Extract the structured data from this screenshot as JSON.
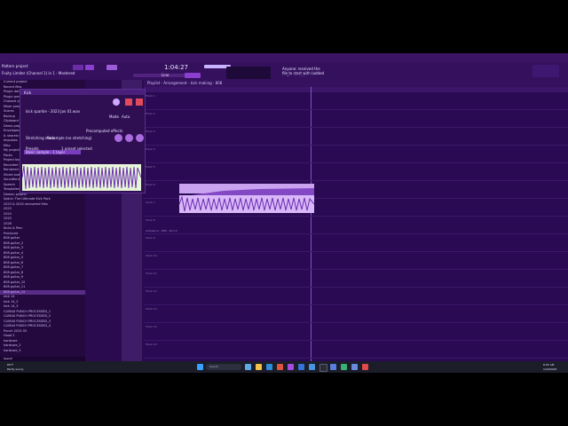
{
  "menubar": {
    "items": [
      "FILE",
      "EDIT",
      "ADD",
      "PATTERNS",
      "VIEW",
      "OPTIONS",
      "TOOLS",
      "HELP"
    ]
  },
  "toolbar": {
    "time": "1:04:27",
    "project_hint": "Pattern project",
    "mode_label": "Pattern",
    "tempo_label": "Line",
    "hint": "Fruity Limiter (Channel 1) in 1 - Mastered",
    "message": "Anyone: received the file to start with (added to Bandwidth)"
  },
  "browser": {
    "search_placeholder": "Search",
    "items": [
      "Current project",
      "Recent files",
      "Plugin database",
      "Plugin presets",
      "Channel presets",
      "Mixer presets",
      "Scores",
      "Backup",
      "Clipboard files",
      "Demo projects",
      "Envelopes",
      "IL shared data",
      "Impulses",
      "Misc",
      "My projects",
      "Packs",
      "Project bones",
      "Recorded",
      "Rendered",
      "Sliced audio",
      "Soundfonts",
      "Speech",
      "Templates",
      "Demon project",
      "Splice: The Ultimate Kick Pack",
      "2023 & 2024 recovered files",
      "2023",
      "2024",
      "2025",
      "2026",
      "Kicks & Perc",
      "Produced",
      "808 guitar",
      "808 guitar_2",
      "808 guitar_3",
      "808 guitar_4",
      "808 guitar_5",
      "808 guitar_6",
      "808 guitar_7",
      "808 guitar_8",
      "808 guitar_9",
      "808 guitar_10",
      "808 guitar_11",
      "808 guitar_12",
      "kick 14",
      "kick 14_2",
      "kick 14_3",
      "CLIMAX PUNCH PROCESSED_1",
      "CLIMAX PUNCH PROCESSED_2",
      "CLIMAX PUNCH PROCESSED_3",
      "CLIMAX PUNCH PROCESSED_4",
      "Punch 2025 05",
      "Hood 2",
      "hardcore",
      "hardcore_2",
      "hardcore_3"
    ],
    "selected_index": 43
  },
  "channel": {
    "title": "Kick",
    "sample_name": "kick sparkle - 2023 Jan 01.wav",
    "mode_label": "Mode",
    "mode_value": "Auto",
    "precomputed_label": "Precomputed effects",
    "stretching_label": "Stretching mode",
    "stretching_value": "Resample (no stretching)",
    "presets_label": "Presets",
    "presets_value": "1 preset selected",
    "selected_preset": "Basic sample - 1 layer"
  },
  "playlist": {
    "title": "Playlist - Arrangement - kick making - 808",
    "rows": [
      "Track 1",
      "Track 2",
      "Track 3",
      "Track 4",
      "Track 5",
      "Track 6",
      "Track 7",
      "Track 8",
      "Track 9",
      "Track 10",
      "Track 11",
      "Track 12",
      "Track 13",
      "Track 14",
      "Track 15"
    ],
    "clip_label": "Ambience - 808 - Punch"
  },
  "taskbar": {
    "weather_temp": "65°F",
    "weather_desc": "Partly sunny",
    "search_placeholder": "Search",
    "time": "6:05 AM",
    "date": "1/29/2025"
  },
  "colors": {
    "accent": "#b36bff",
    "background": "#2a0a52",
    "taskbar": "#1b1d29"
  }
}
